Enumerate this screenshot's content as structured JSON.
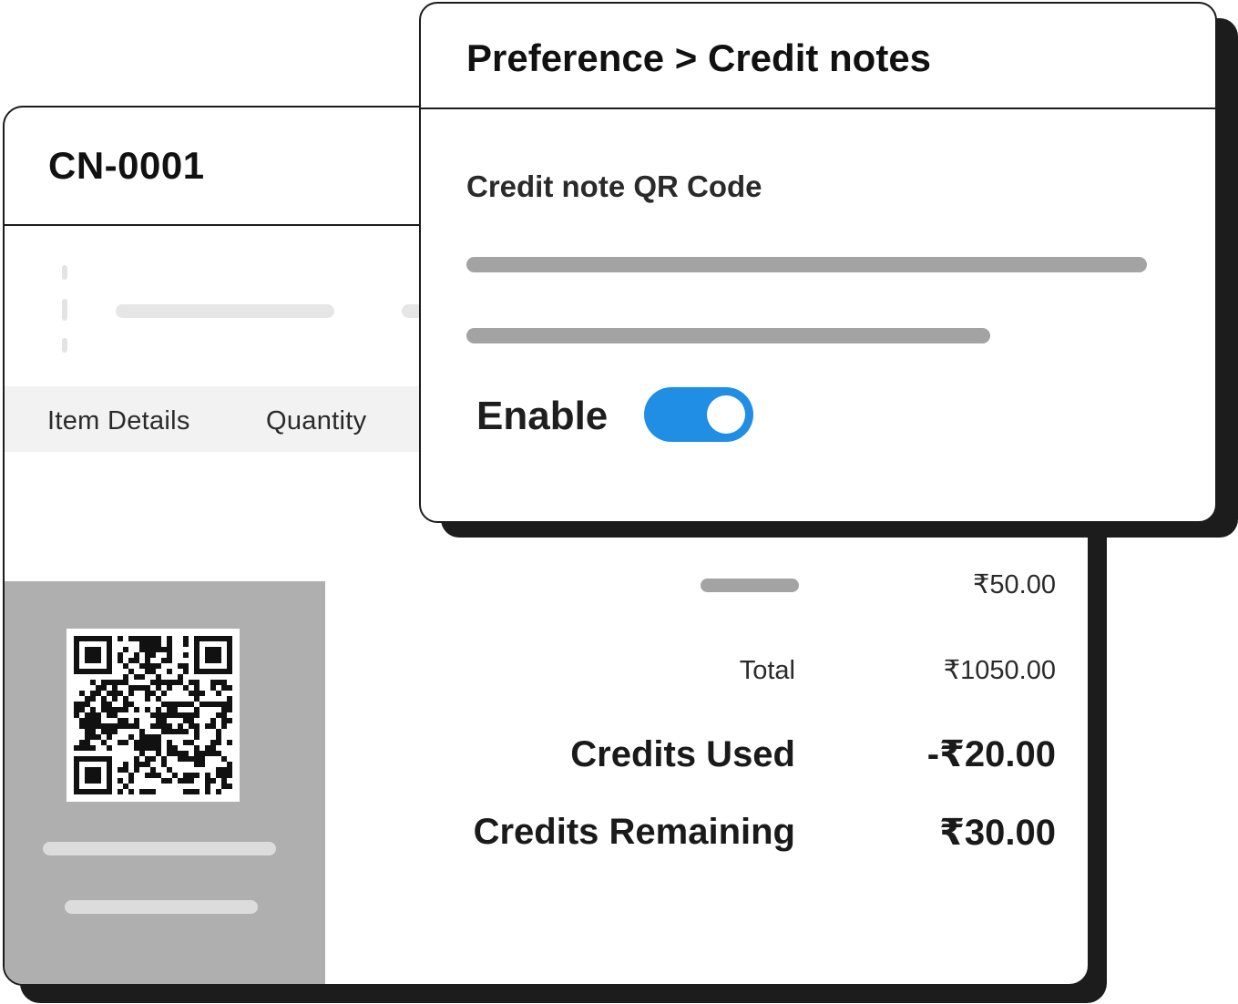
{
  "credit_note": {
    "number": "CN-0001",
    "table_headers": [
      "Item Details",
      "Quantity"
    ],
    "summary": {
      "subline_value": "₹50.00",
      "total_label": "Total",
      "total_value": "₹1050.00",
      "credits_used_label": "Credits Used",
      "credits_used_value": "-₹20.00",
      "credits_remaining_label": "Credits Remaining",
      "credits_remaining_value": "₹30.00"
    },
    "qr_icon": "qr-code-icon"
  },
  "preference_popup": {
    "title": "Preference > Credit notes",
    "section_title": "Credit note QR Code",
    "enable_label": "Enable",
    "enable_toggle_on": true
  },
  "colors": {
    "toggle_on": "#208ee4",
    "qr_panel": "#b0afaf",
    "border": "#1c1c1c"
  }
}
